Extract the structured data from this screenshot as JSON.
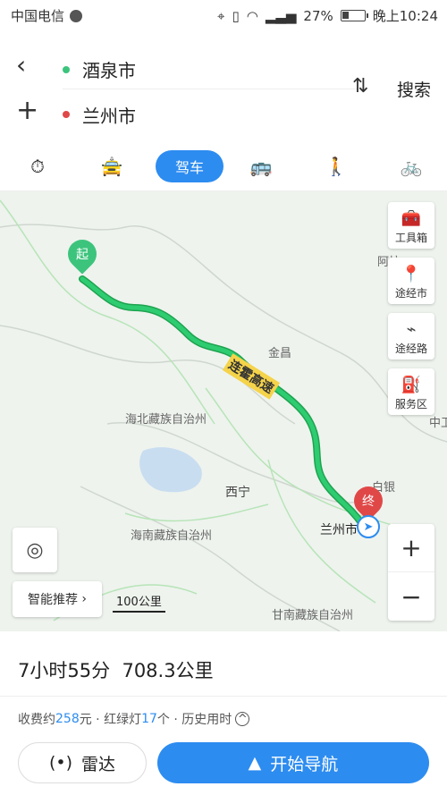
{
  "status": {
    "carrier": "中国电信",
    "battery": "27%",
    "time": "晚上10:24"
  },
  "route": {
    "origin": "酒泉市",
    "destination": "兰州市",
    "search_label": "搜索",
    "origin_color": "#3cc47c",
    "destination_color": "#e04848"
  },
  "tabs": [
    {
      "icon": "stopwatch-icon",
      "label": ""
    },
    {
      "icon": "taxi-icon",
      "label": ""
    },
    {
      "icon": "car-icon",
      "label": "驾车"
    },
    {
      "icon": "bus-icon",
      "label": ""
    },
    {
      "icon": "walk-icon",
      "label": ""
    },
    {
      "icon": "bike-icon",
      "label": ""
    }
  ],
  "map": {
    "labels": {
      "region1": "海北藏族自治州",
      "region2": "海南藏族自治州",
      "region3": "甘南藏族自治州",
      "city1": "西宁",
      "city2": "金昌",
      "city3": "白银",
      "city4": "兰州市",
      "partial1": "阿拉",
      "partial2": "中卫"
    },
    "highway": "连霍高速",
    "start_pin": "起",
    "end_pin": "终",
    "tools": [
      "工具箱",
      "途经市",
      "途经路",
      "服务区"
    ],
    "smart_recommend": "智能推荐",
    "scale": "100公里",
    "zoom_in": "+",
    "zoom_out": "−"
  },
  "summary": {
    "duration": "7小时55分",
    "distance": "708.3公里"
  },
  "details": {
    "toll_prefix": "收费约",
    "toll_value": "258",
    "toll_suffix": "元 · 红绿灯",
    "lights_value": "17",
    "lights_suffix": "个 · 历史用时"
  },
  "buttons": {
    "radar": "雷达",
    "start_nav": "开始导航"
  },
  "colors": {
    "accent": "#2d8cf0",
    "route": "#2ecc71"
  }
}
